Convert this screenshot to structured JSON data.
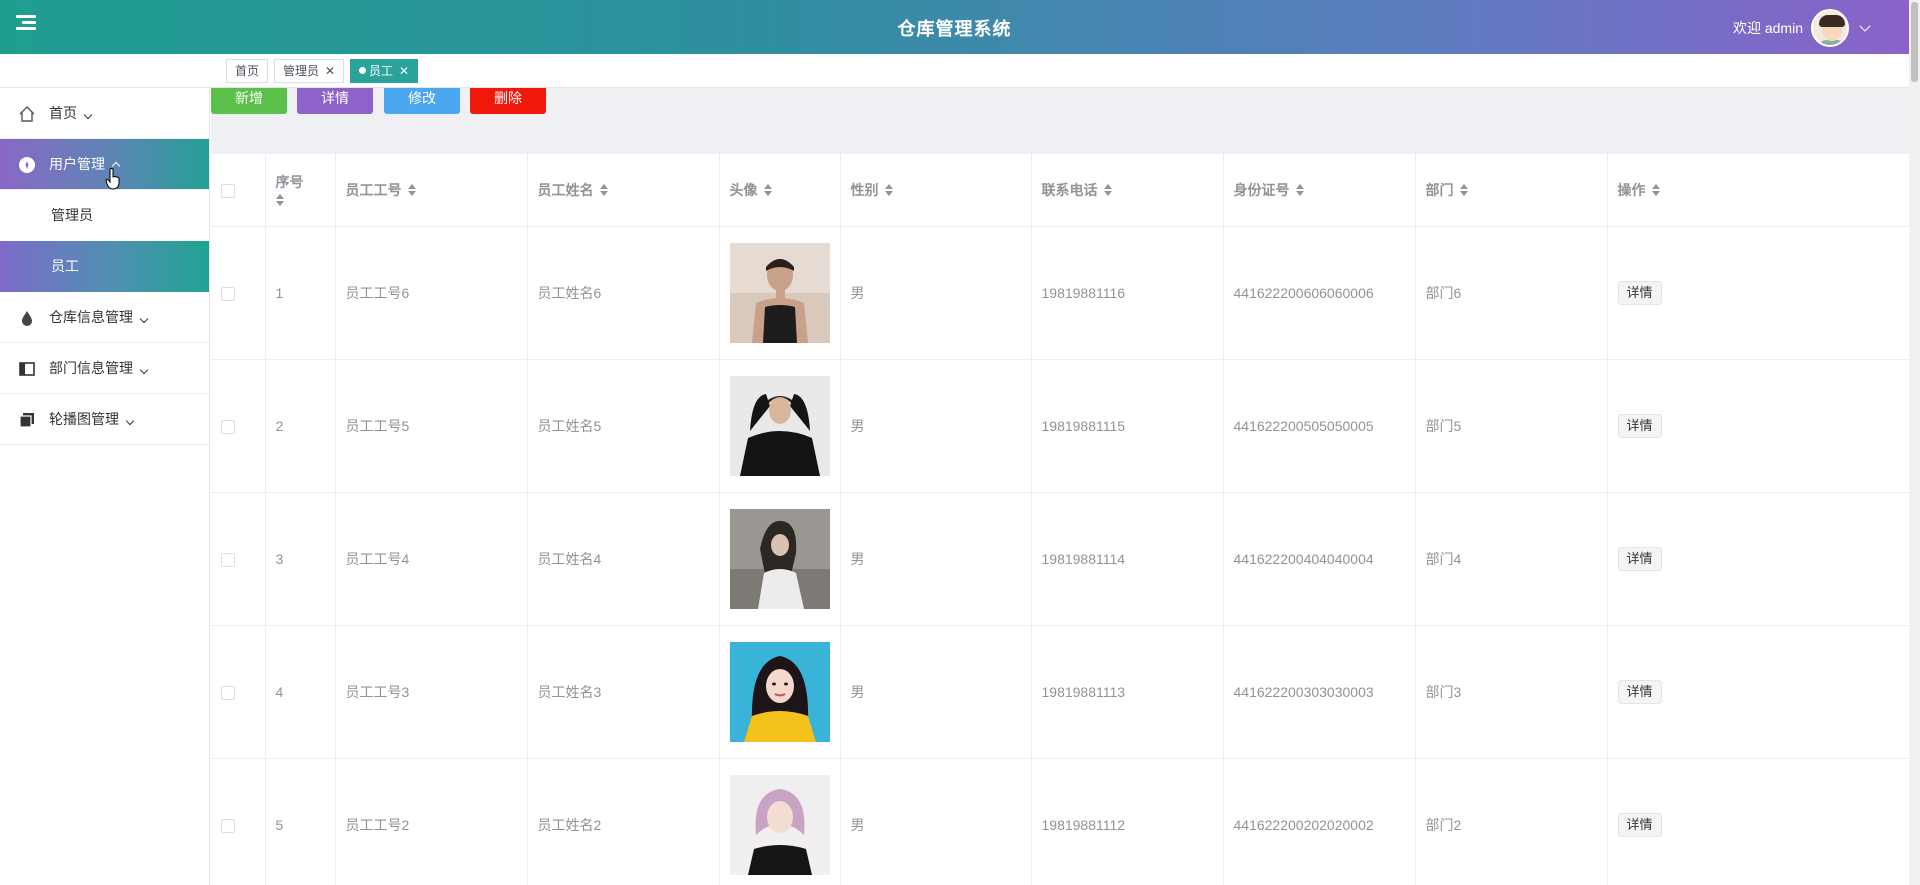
{
  "header": {
    "title": "仓库管理系统",
    "welcome": "欢迎 admin"
  },
  "tabs": [
    {
      "label": "首页",
      "closable": false,
      "active": false
    },
    {
      "label": "管理员",
      "closable": true,
      "active": false
    },
    {
      "label": "员工",
      "closable": true,
      "active": true
    }
  ],
  "sidebar": {
    "items": [
      {
        "label": "首页",
        "icon": "home-icon"
      },
      {
        "label": "用户管理",
        "icon": "user-circle-icon",
        "open": true,
        "children": [
          {
            "label": "管理员"
          },
          {
            "label": "员工",
            "active": true
          }
        ]
      },
      {
        "label": "仓库信息管理",
        "icon": "drop-icon"
      },
      {
        "label": "部门信息管理",
        "icon": "panel-icon"
      },
      {
        "label": "轮播图管理",
        "icon": "copy-icon"
      }
    ]
  },
  "toolbar": {
    "add": "新增",
    "detail": "详情",
    "edit": "修改",
    "delete": "删除"
  },
  "table": {
    "columns": [
      "序号",
      "员工工号",
      "员工姓名",
      "头像",
      "性别",
      "联系电话",
      "身份证号",
      "部门",
      "操作"
    ],
    "rows": [
      {
        "index": "1",
        "code": "员工工号6",
        "name": "员工姓名6",
        "avatar": "photo-man-tank-top",
        "gender": "男",
        "phone": "19819881116",
        "idcard": "441622200606060006",
        "dept": "部门6",
        "op": "详情"
      },
      {
        "index": "2",
        "code": "员工工号5",
        "name": "员工姓名5",
        "avatar": "photo-man-black-sweater",
        "gender": "男",
        "phone": "19819881115",
        "idcard": "441622200505050005",
        "dept": "部门5",
        "op": "详情"
      },
      {
        "index": "3",
        "code": "员工工号4",
        "name": "员工姓名4",
        "avatar": "photo-woman-white-shirt",
        "gender": "男",
        "phone": "19819881114",
        "idcard": "441622200404040004",
        "dept": "部门4",
        "op": "详情"
      },
      {
        "index": "4",
        "code": "员工工号3",
        "name": "员工姓名3",
        "avatar": "photo-woman-yellow",
        "gender": "男",
        "phone": "19819881113",
        "idcard": "441622200303030003",
        "dept": "部门3",
        "op": "详情"
      },
      {
        "index": "5",
        "code": "员工工号2",
        "name": "员工姓名2",
        "avatar": "photo-woman-pink-hair",
        "gender": "男",
        "phone": "19819881112",
        "idcard": "441622200202020002",
        "dept": "部门2",
        "op": "详情"
      }
    ]
  },
  "colors": {
    "header_start": "#1f9e8f",
    "header_end": "#8a62c9",
    "add": "#5bc14a",
    "detail": "#8e63c9",
    "edit": "#4ba7ef",
    "delete": "#f0180b"
  }
}
